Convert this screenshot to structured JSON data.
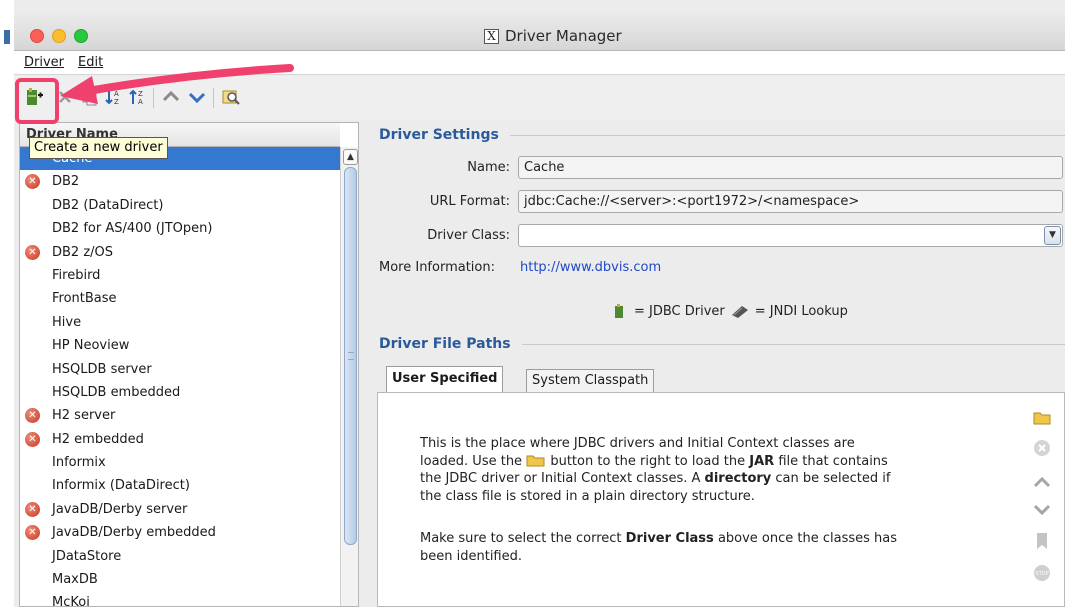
{
  "window": {
    "title": "Driver Manager"
  },
  "menu": {
    "items": [
      "Driver",
      "Edit"
    ]
  },
  "toolbar": {
    "buttons": [
      {
        "name": "create-driver",
        "icon": "new-driver-icon"
      },
      {
        "name": "delete",
        "icon": "delete-icon"
      },
      {
        "name": "copy",
        "icon": "copy-icon"
      },
      {
        "name": "sort-ascending",
        "icon": "sort-asc-icon"
      },
      {
        "name": "sort-descending",
        "icon": "sort-desc-icon"
      },
      {
        "name": "move-up",
        "icon": "chevron-up-icon"
      },
      {
        "name": "move-down",
        "icon": "chevron-down-icon"
      },
      {
        "name": "find",
        "icon": "find-icon"
      }
    ],
    "tooltip": "Create a new driver"
  },
  "driver_list": {
    "header": "Driver Name",
    "rows": [
      {
        "label": "Cache",
        "error": false,
        "selected": true
      },
      {
        "label": "DB2",
        "error": true,
        "selected": false
      },
      {
        "label": "DB2 (DataDirect)",
        "error": false,
        "selected": false
      },
      {
        "label": "DB2 for AS/400 (JTOpen)",
        "error": false,
        "selected": false
      },
      {
        "label": "DB2 z/OS",
        "error": true,
        "selected": false
      },
      {
        "label": "Firebird",
        "error": false,
        "selected": false
      },
      {
        "label": "FrontBase",
        "error": false,
        "selected": false
      },
      {
        "label": "Hive",
        "error": false,
        "selected": false
      },
      {
        "label": "HP Neoview",
        "error": false,
        "selected": false
      },
      {
        "label": "HSQLDB server",
        "error": false,
        "selected": false
      },
      {
        "label": "HSQLDB embedded",
        "error": false,
        "selected": false
      },
      {
        "label": "H2 server",
        "error": true,
        "selected": false
      },
      {
        "label": "H2 embedded",
        "error": true,
        "selected": false
      },
      {
        "label": "Informix",
        "error": false,
        "selected": false
      },
      {
        "label": "Informix (DataDirect)",
        "error": false,
        "selected": false
      },
      {
        "label": "JavaDB/Derby server",
        "error": true,
        "selected": false
      },
      {
        "label": "JavaDB/Derby embedded",
        "error": true,
        "selected": false
      },
      {
        "label": "JDataStore",
        "error": false,
        "selected": false
      },
      {
        "label": "MaxDB",
        "error": false,
        "selected": false
      },
      {
        "label": "McKoi",
        "error": false,
        "selected": false
      }
    ]
  },
  "driver_settings": {
    "section_title": "Driver Settings",
    "name_label": "Name:",
    "name_value": "Cache",
    "url_label": "URL Format:",
    "url_value": "jdbc:Cache://<server>:<port1972>/<namespace>",
    "class_label": "Driver Class:",
    "class_value": "",
    "more_info_label": "More Information:",
    "more_info_link": "http://www.dbvis.com",
    "legend_jdbc": "= JDBC Driver",
    "legend_jndi": "= JNDI Lookup"
  },
  "file_paths": {
    "section_title": "Driver File Paths",
    "tabs": [
      "User Specified",
      "System Classpath"
    ],
    "para1_a": "This is the place where JDBC drivers and Initial Context classes are",
    "para1_b1": "loaded. Use the",
    "para1_b2": "button to the right to load the",
    "para1_b_bold": "JAR",
    "para1_b3": "file that contains",
    "para1_c1": "the JDBC driver or Initial Context classes. A",
    "para1_c_bold": "directory",
    "para1_c2": "can be selected if",
    "para1_d": "the class file is stored in a plain directory structure.",
    "para2_a1": "Make sure to select the correct",
    "para2_a_bold": "Driver Class",
    "para2_a2": "above once the classes has",
    "para2_b": "been identified.",
    "side_icons": [
      "open-folder-icon",
      "remove-icon",
      "move-up-icon",
      "move-down-icon",
      "bookmark-icon",
      "stop-icon"
    ]
  },
  "colors": {
    "selection": "#3478d0",
    "section_title": "#2a5a99",
    "annotation": "#f0406e",
    "link": "#1f49c7"
  }
}
